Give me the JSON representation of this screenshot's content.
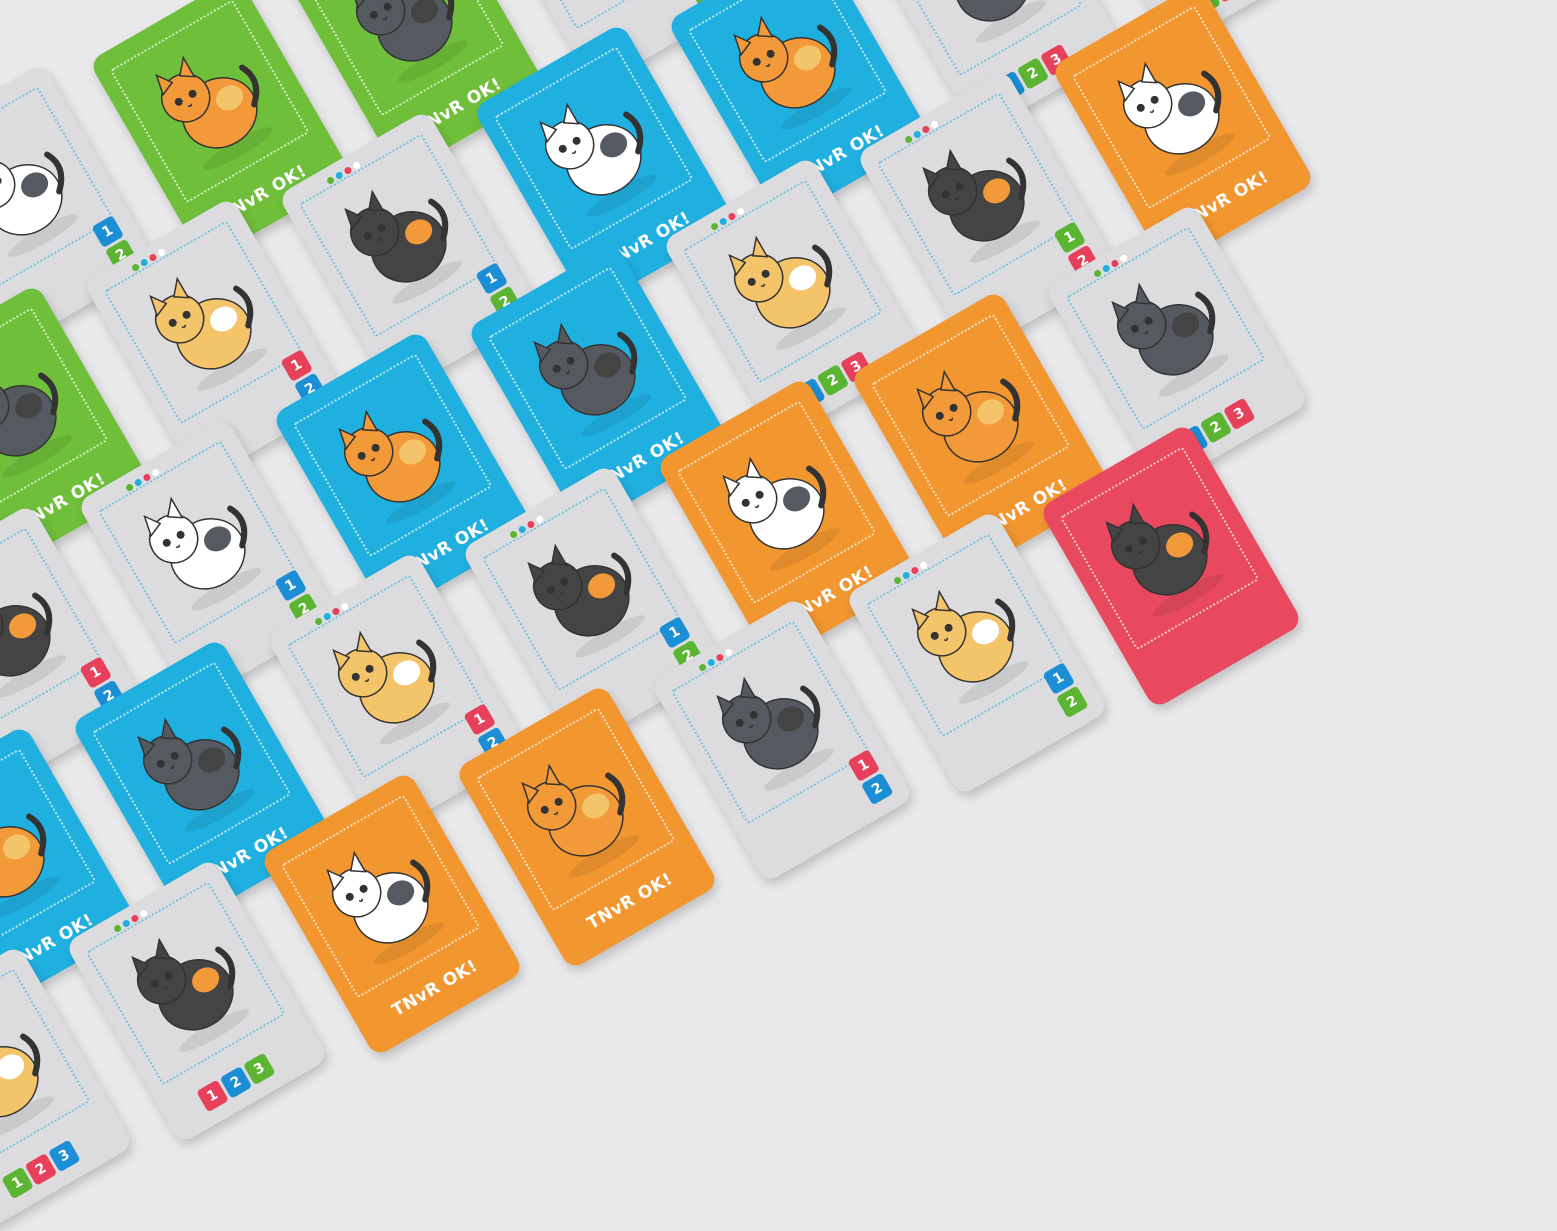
{
  "back_text": "TNvR OK!",
  "colors": {
    "background": "#e9e9eb",
    "front": "#dcdcdf",
    "green": "#6fbf3a",
    "blue": "#20b0e0",
    "orange": "#f2962f",
    "red": "#e8495e",
    "num_blue": "#1c8ed6",
    "num_green": "#5cb532",
    "num_red": "#e6405a"
  },
  "cards": [
    {
      "kind": "front",
      "boxes": [
        "1",
        "2"
      ]
    },
    {
      "kind": "green",
      "label": "TNvR OK!"
    },
    {
      "kind": "green",
      "label": "TNvR OK!"
    },
    {
      "kind": "front",
      "boxes": [
        "1",
        "2"
      ]
    },
    {
      "kind": "front",
      "boxes": [
        "1",
        "2"
      ]
    },
    {
      "kind": "blue",
      "label": "TNvR OK!"
    },
    {
      "kind": "blue",
      "label": "TNvR OK!"
    },
    {
      "kind": "green",
      "label": "TNvR OK!"
    },
    {
      "kind": "front",
      "boxes": [
        "1",
        "2"
      ]
    },
    {
      "kind": "front",
      "boxes": [
        "1",
        "2"
      ]
    },
    {
      "kind": "blue",
      "label": "TNvR OK!"
    },
    {
      "kind": "blue",
      "label": "TNvR OK!"
    },
    {
      "kind": "front",
      "boxes": [
        "1",
        "2",
        "3"
      ]
    },
    {
      "kind": "front",
      "boxes": [
        "1",
        "2",
        "3"
      ]
    },
    {
      "kind": "front",
      "boxes": [
        "1",
        "2"
      ]
    },
    {
      "kind": "front",
      "boxes": [
        "1",
        "2"
      ]
    },
    {
      "kind": "blue",
      "label": "TNvR OK!"
    },
    {
      "kind": "blue",
      "label": "TNvR OK!"
    },
    {
      "kind": "front",
      "boxes": [
        "1",
        "2",
        "3"
      ]
    },
    {
      "kind": "front",
      "boxes": [
        "1",
        "2"
      ]
    },
    {
      "kind": "orange",
      "label": "TNvR OK!"
    },
    {
      "kind": "blue",
      "label": "TNvR OK!"
    },
    {
      "kind": "blue",
      "label": "TNvR OK!"
    },
    {
      "kind": "front",
      "boxes": [
        "1",
        "2"
      ]
    },
    {
      "kind": "front",
      "boxes": [
        "1",
        "2"
      ]
    },
    {
      "kind": "orange",
      "label": "TNvR OK!"
    },
    {
      "kind": "orange",
      "label": "TNvR OK!"
    },
    {
      "kind": "front",
      "boxes": [
        "1",
        "2",
        "3"
      ]
    },
    {
      "kind": "front",
      "boxes": [
        "1",
        "2",
        "3"
      ]
    },
    {
      "kind": "front",
      "boxes": [
        "1",
        "2",
        "3"
      ]
    },
    {
      "kind": "orange",
      "label": "TNvR OK!"
    },
    {
      "kind": "orange",
      "label": "TNvR OK!"
    },
    {
      "kind": "front",
      "boxes": [
        "1",
        "2"
      ]
    },
    {
      "kind": "front",
      "boxes": [
        "1",
        "2"
      ]
    },
    {
      "kind": "red",
      "label": ""
    }
  ]
}
